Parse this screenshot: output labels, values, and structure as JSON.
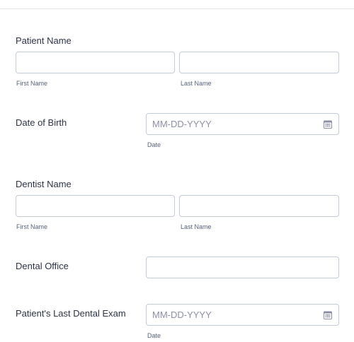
{
  "patient_name": {
    "label": "Patient Name",
    "first_sublabel": "First Name",
    "last_sublabel": "Last Name",
    "first_value": "",
    "last_value": ""
  },
  "date_of_birth": {
    "label": "Date of Birth",
    "placeholder": "MM-DD-YYYY",
    "sublabel": "Date",
    "icon": "calendar-icon"
  },
  "dentist_name": {
    "label": "Dentist Name",
    "first_sublabel": "First Name",
    "last_sublabel": "Last Name",
    "first_value": "",
    "last_value": ""
  },
  "dental_office": {
    "label": "Dental Office",
    "value": ""
  },
  "last_dental_exam": {
    "label": "Patient's Last Dental Exam",
    "placeholder": "MM-DD-YYYY",
    "sublabel": "Date",
    "icon": "calendar-icon"
  }
}
